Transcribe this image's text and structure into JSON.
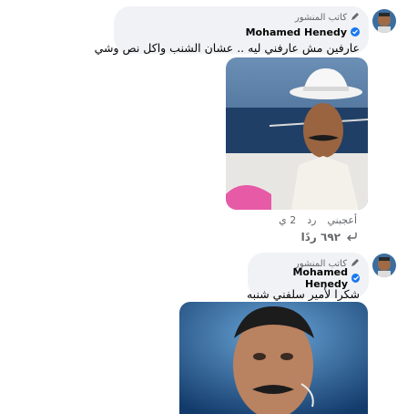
{
  "comments": [
    {
      "author_badge": "كاتب المنشور",
      "author_name": "Mohamed Henedy",
      "text": "عارفين مش عارفني ليه .. عشان الشنب واكل نص وشي",
      "actions": {
        "like": "أعجبني",
        "reply": "رد",
        "time": "2 ي"
      },
      "replies_label": "٦٩٢ ردًا"
    },
    {
      "author_badge": "كاتب المنشور",
      "author_name": "Mohamed Henedy",
      "text": "شكرا لأمير سلفني شنبه"
    }
  ],
  "colors": {
    "bubble_bg": "#f0f2f5",
    "verified_blue": "#1877f2",
    "meta_gray": "#65676b"
  },
  "icons": {
    "pencil": "pencil-icon",
    "verified": "verified-badge-icon",
    "reply_arrow": "reply-arrow-icon"
  }
}
